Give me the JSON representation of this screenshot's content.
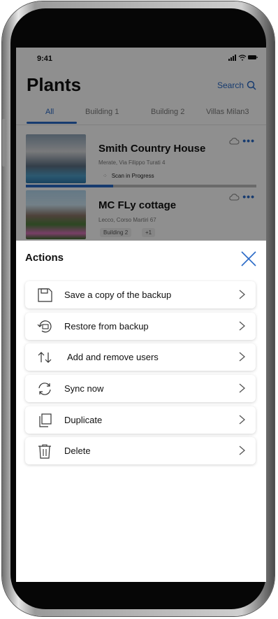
{
  "status_bar": {
    "time": "9:41",
    "icons": "signal-wifi-battery"
  },
  "header": {
    "title": "Plants",
    "search_label": "Search"
  },
  "tabs": [
    {
      "label": "All",
      "active": true
    },
    {
      "label": "Building 1",
      "active": false
    },
    {
      "label": "Building 2",
      "active": false
    },
    {
      "label": "Villas Milan3",
      "active": false
    }
  ],
  "cards": [
    {
      "title": "Smith Country House",
      "address": "Merate, Via Filippo Turati 4",
      "status": "Scan in Progress",
      "progress": 0.38
    },
    {
      "title": "MC FLy cottage",
      "address": "Lecco, Corso Martiri 67",
      "badges": [
        "Building 2",
        "+1"
      ]
    }
  ],
  "sheet": {
    "title": "Actions",
    "actions": [
      {
        "label": "Save a copy of the backup",
        "icon": "save-icon"
      },
      {
        "label": "Restore from backup",
        "icon": "restore-icon"
      },
      {
        "label": "Add and remove users",
        "icon": "users-swap-icon"
      },
      {
        "label": "Sync now",
        "icon": "sync-icon"
      },
      {
        "label": "Duplicate",
        "icon": "duplicate-icon"
      },
      {
        "label": "Delete",
        "icon": "trash-icon"
      }
    ]
  },
  "colors": {
    "accent": "#2a6ac7",
    "text": "#111111",
    "muted": "#7a7a7a"
  }
}
